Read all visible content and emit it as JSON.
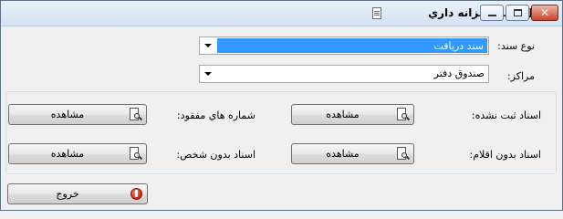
{
  "window": {
    "title": "كنترل اسناد خزانه داري"
  },
  "fields": {
    "doc_type_label": "نوع سند:",
    "doc_type_value": "سند دريافت",
    "centers_label": "مراكز:",
    "centers_value": "صندوق دفتر"
  },
  "group": {
    "unregistered_label": "اسناد ثبت نشده:",
    "missing_numbers_label": "شماره هاي مفقود:",
    "no_items_label": "اسناد بدون اقلام:",
    "no_person_label": "اسناد بدون شخص:",
    "view_label": "مشاهده"
  },
  "footer": {
    "exit_label": "خروج"
  },
  "colors": {
    "selection": "#3399ff",
    "close_button": "#c8432c"
  }
}
